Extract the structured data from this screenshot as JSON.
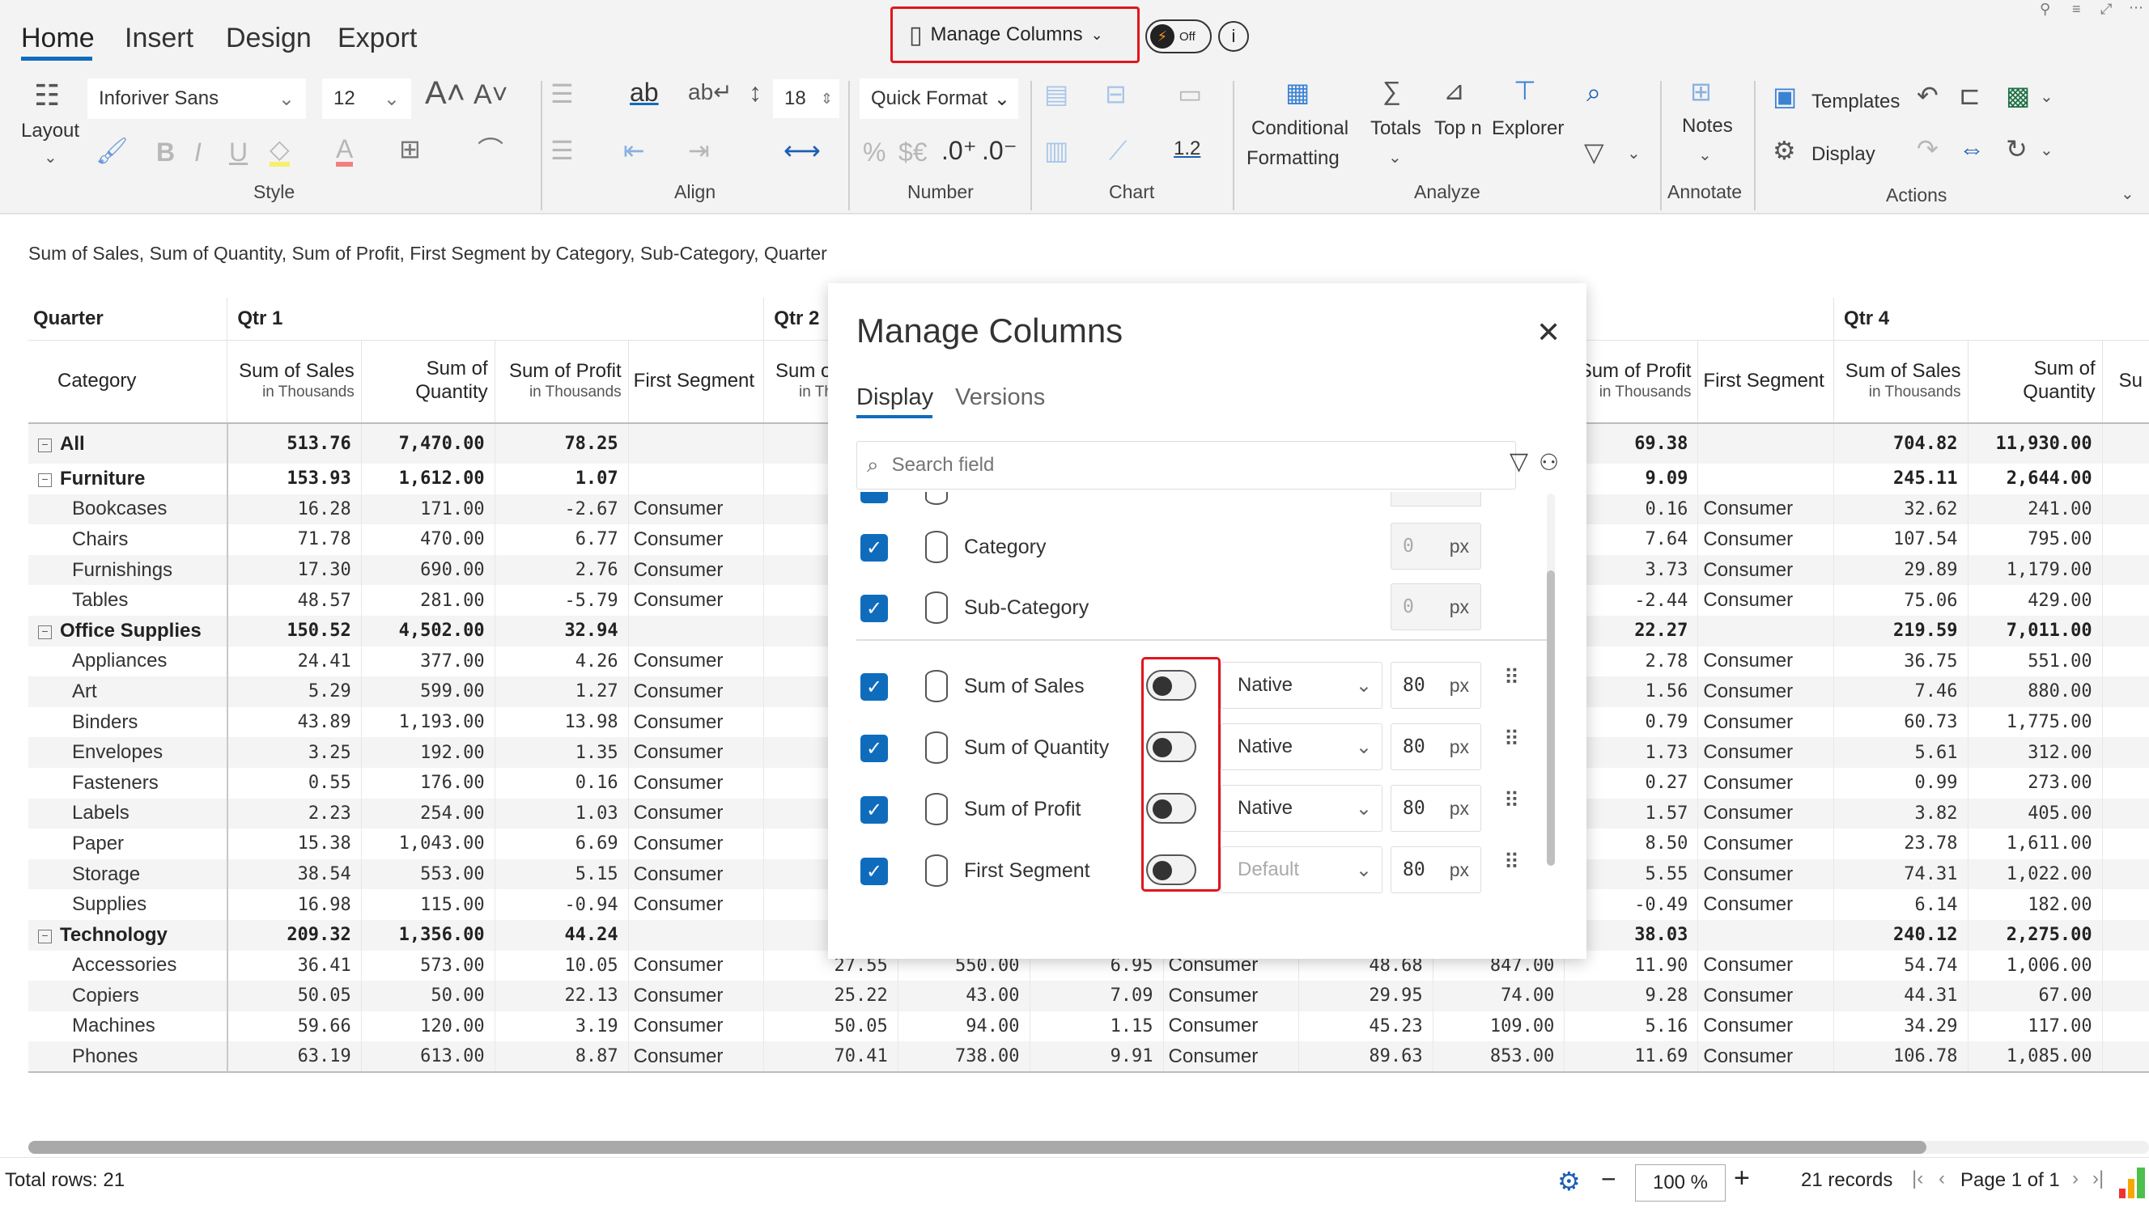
{
  "ribbon": {
    "tabs": [
      "Home",
      "Insert",
      "Design",
      "Export"
    ],
    "active_tab": "Home",
    "layout_label": "Layout",
    "font_family": "Inforiver Sans",
    "font_size": "12",
    "row_height": "18",
    "quick_format": "Quick Format",
    "manage_columns": "Manage Columns",
    "toggle_label": "Off",
    "groups": {
      "style": "Style",
      "align": "Align",
      "number": "Number",
      "chart": "Chart",
      "analyze": "Analyze",
      "annotate": "Annotate",
      "actions": "Actions"
    },
    "analyze_buttons": {
      "conditional_1": "Conditional",
      "conditional_2": "Formatting",
      "totals": "Totals",
      "topn": "Top n",
      "explorer": "Explorer"
    },
    "notes": "Notes",
    "templates": "Templates",
    "display": "Display",
    "data_label_icon": "1.2",
    "number_icons": {
      "percent": "%",
      "currency": "$€",
      "inc_decimal": ".0⁺",
      "dec_decimal": ".0⁻"
    }
  },
  "subtitle": "Sum of Sales, Sum of Quantity, Sum of Profit, First Segment by Category, Sub-Category, Quarter",
  "table": {
    "corner_row1": "Quarter",
    "corner_row2": "Category",
    "quarters": [
      "Qtr 1",
      "Qtr 2",
      "Qtr 4"
    ],
    "measure_headers": {
      "sales": {
        "title": "Sum of Sales",
        "sub": "in Thousands"
      },
      "quantity": {
        "title": "Sum of",
        "sub": "Quantity"
      },
      "profit": {
        "title": "Sum of Profit",
        "sub": "in Thousands"
      },
      "segment": {
        "title": "First Segment"
      },
      "sales_partial": {
        "title": "Sum",
        "sub": "in T"
      },
      "partial_right": "Su"
    },
    "rows": [
      {
        "label": "All",
        "group": true,
        "q1": [
          "513.76",
          "7,470.00",
          "78.25",
          ""
        ],
        "q2": [
          "",
          "",
          "",
          ""
        ],
        "q3": [
          "",
          "",
          "69.38",
          ""
        ],
        "q4": [
          "704.82",
          "11,930.00"
        ]
      },
      {
        "label": "Furniture",
        "group": true,
        "q1": [
          "153.93",
          "1,612.00",
          "1.07",
          ""
        ],
        "q2": [
          "",
          "",
          "",
          ""
        ],
        "q3": [
          "",
          "",
          "9.09",
          ""
        ],
        "q4": [
          "245.11",
          "2,644.00"
        ]
      },
      {
        "label": "Bookcases",
        "q1": [
          "16.28",
          "171.00",
          "-2.67",
          "Consumer"
        ],
        "q2": [
          "",
          "",
          "",
          ""
        ],
        "q3": [
          "",
          "",
          "0.16",
          "Consumer"
        ],
        "q4": [
          "32.62",
          "241.00"
        ]
      },
      {
        "label": "Chairs",
        "q1": [
          "71.78",
          "470.00",
          "6.77",
          "Consumer"
        ],
        "q2": [
          "",
          "",
          "",
          ""
        ],
        "q3": [
          "",
          "",
          "7.64",
          "Consumer"
        ],
        "q4": [
          "107.54",
          "795.00"
        ]
      },
      {
        "label": "Furnishings",
        "q1": [
          "17.30",
          "690.00",
          "2.76",
          "Consumer"
        ],
        "q2": [
          "",
          "",
          "",
          ""
        ],
        "q3": [
          "",
          "",
          "3.73",
          "Consumer"
        ],
        "q4": [
          "29.89",
          "1,179.00"
        ]
      },
      {
        "label": "Tables",
        "q1": [
          "48.57",
          "281.00",
          "-5.79",
          "Consumer"
        ],
        "q2": [
          "",
          "",
          "",
          ""
        ],
        "q3": [
          "",
          "",
          "-2.44",
          "Consumer"
        ],
        "q4": [
          "75.06",
          "429.00"
        ]
      },
      {
        "label": "Office Supplies",
        "group": true,
        "q1": [
          "150.52",
          "4,502.00",
          "32.94",
          ""
        ],
        "q2": [
          "",
          "",
          "",
          ""
        ],
        "q3": [
          "",
          "",
          "22.27",
          ""
        ],
        "q4": [
          "219.59",
          "7,011.00"
        ]
      },
      {
        "label": "Appliances",
        "q1": [
          "24.41",
          "377.00",
          "4.26",
          "Consumer"
        ],
        "q2": [
          "",
          "",
          "",
          ""
        ],
        "q3": [
          "",
          "",
          "2.78",
          "Consumer"
        ],
        "q4": [
          "36.75",
          "551.00"
        ]
      },
      {
        "label": "Art",
        "q1": [
          "5.29",
          "599.00",
          "1.27",
          "Consumer"
        ],
        "q2": [
          "",
          "",
          "",
          ""
        ],
        "q3": [
          "",
          "",
          "1.56",
          "Consumer"
        ],
        "q4": [
          "7.46",
          "880.00"
        ]
      },
      {
        "label": "Binders",
        "q1": [
          "43.89",
          "1,193.00",
          "13.98",
          "Consumer"
        ],
        "q2": [
          "",
          "",
          "",
          ""
        ],
        "q3": [
          "",
          "",
          "0.79",
          "Consumer"
        ],
        "q4": [
          "60.73",
          "1,775.00"
        ]
      },
      {
        "label": "Envelopes",
        "q1": [
          "3.25",
          "192.00",
          "1.35",
          "Consumer"
        ],
        "q2": [
          "",
          "",
          "",
          ""
        ],
        "q3": [
          "",
          "",
          "1.73",
          "Consumer"
        ],
        "q4": [
          "5.61",
          "312.00"
        ]
      },
      {
        "label": "Fasteners",
        "q1": [
          "0.55",
          "176.00",
          "0.16",
          "Consumer"
        ],
        "q2": [
          "",
          "",
          "",
          ""
        ],
        "q3": [
          "",
          "",
          "0.27",
          "Consumer"
        ],
        "q4": [
          "0.99",
          "273.00"
        ]
      },
      {
        "label": "Labels",
        "q1": [
          "2.23",
          "254.00",
          "1.03",
          "Consumer"
        ],
        "q2": [
          "",
          "",
          "",
          ""
        ],
        "q3": [
          "",
          "",
          "1.57",
          "Consumer"
        ],
        "q4": [
          "3.82",
          "405.00"
        ]
      },
      {
        "label": "Paper",
        "q1": [
          "15.38",
          "1,043.00",
          "6.69",
          "Consumer"
        ],
        "q2": [
          "",
          "",
          "",
          ""
        ],
        "q3": [
          "",
          "",
          "8.50",
          "Consumer"
        ],
        "q4": [
          "23.78",
          "1,611.00"
        ]
      },
      {
        "label": "Storage",
        "q1": [
          "38.54",
          "553.00",
          "5.15",
          "Consumer"
        ],
        "q2": [
          "",
          "",
          "",
          ""
        ],
        "q3": [
          "",
          "",
          "5.55",
          "Consumer"
        ],
        "q4": [
          "74.31",
          "1,022.00"
        ]
      },
      {
        "label": "Supplies",
        "q1": [
          "16.98",
          "115.00",
          "-0.94",
          "Consumer"
        ],
        "q2": [
          "",
          "",
          "",
          ""
        ],
        "q3": [
          "",
          "",
          "-0.49",
          "Consumer"
        ],
        "q4": [
          "6.14",
          "182.00"
        ]
      },
      {
        "label": "Technology",
        "group": true,
        "q1": [
          "209.32",
          "1,356.00",
          "44.24",
          ""
        ],
        "q2": [
          "",
          "",
          "",
          ""
        ],
        "q3": [
          "",
          "",
          "38.03",
          ""
        ],
        "q4": [
          "240.12",
          "2,275.00"
        ]
      },
      {
        "label": "Accessories",
        "q1": [
          "36.41",
          "573.00",
          "10.05",
          "Consumer"
        ],
        "q2": [
          "27.55",
          "550.00",
          "6.95",
          "Consumer"
        ],
        "q3": [
          "48.68",
          "847.00",
          "11.90",
          "Consumer"
        ],
        "q4": [
          "54.74",
          "1,006.00"
        ]
      },
      {
        "label": "Copiers",
        "q1": [
          "50.05",
          "50.00",
          "22.13",
          "Consumer"
        ],
        "q2": [
          "25.22",
          "43.00",
          "7.09",
          "Consumer"
        ],
        "q3": [
          "29.95",
          "74.00",
          "9.28",
          "Consumer"
        ],
        "q4": [
          "44.31",
          "67.00"
        ]
      },
      {
        "label": "Machines",
        "q1": [
          "59.66",
          "120.00",
          "3.19",
          "Consumer"
        ],
        "q2": [
          "50.05",
          "94.00",
          "1.15",
          "Consumer"
        ],
        "q3": [
          "45.23",
          "109.00",
          "5.16",
          "Consumer"
        ],
        "q4": [
          "34.29",
          "117.00"
        ]
      },
      {
        "label": "Phones",
        "q1": [
          "63.19",
          "613.00",
          "8.87",
          "Consumer"
        ],
        "q2": [
          "70.41",
          "738.00",
          "9.91",
          "Consumer"
        ],
        "q3": [
          "89.63",
          "853.00",
          "11.69",
          "Consumer"
        ],
        "q4": [
          "106.78",
          "1,085.00"
        ]
      }
    ]
  },
  "modal": {
    "title": "Manage Columns",
    "tabs": [
      "Display",
      "Versions"
    ],
    "active_tab": "Display",
    "search_placeholder": "Search field",
    "dimension_rows": [
      {
        "label": "Category",
        "checked": true,
        "width": "0",
        "unit": "px"
      },
      {
        "label": "Sub-Category",
        "checked": true,
        "width": "0",
        "unit": "px"
      }
    ],
    "measure_rows": [
      {
        "label": "Sum of Sales",
        "checked": true,
        "toggle_on": false,
        "format": "Native",
        "width": "80",
        "unit": "px"
      },
      {
        "label": "Sum of Quantity",
        "checked": true,
        "toggle_on": false,
        "format": "Native",
        "width": "80",
        "unit": "px"
      },
      {
        "label": "Sum of Profit",
        "checked": true,
        "toggle_on": false,
        "format": "Native",
        "width": "80",
        "unit": "px"
      },
      {
        "label": "First Segment",
        "checked": true,
        "toggle_on": false,
        "format": "Default",
        "width": "80",
        "unit": "px"
      }
    ]
  },
  "status": {
    "total_rows": "Total rows: 21",
    "zoom": "100 %",
    "records": "21 records",
    "page": "Page 1 of 1"
  },
  "colors": {
    "accent": "#0f6cbd",
    "highlight": "#e0161d",
    "alt_row": "#f4f4f4",
    "ribbon_bg": "#f3f3f3"
  }
}
